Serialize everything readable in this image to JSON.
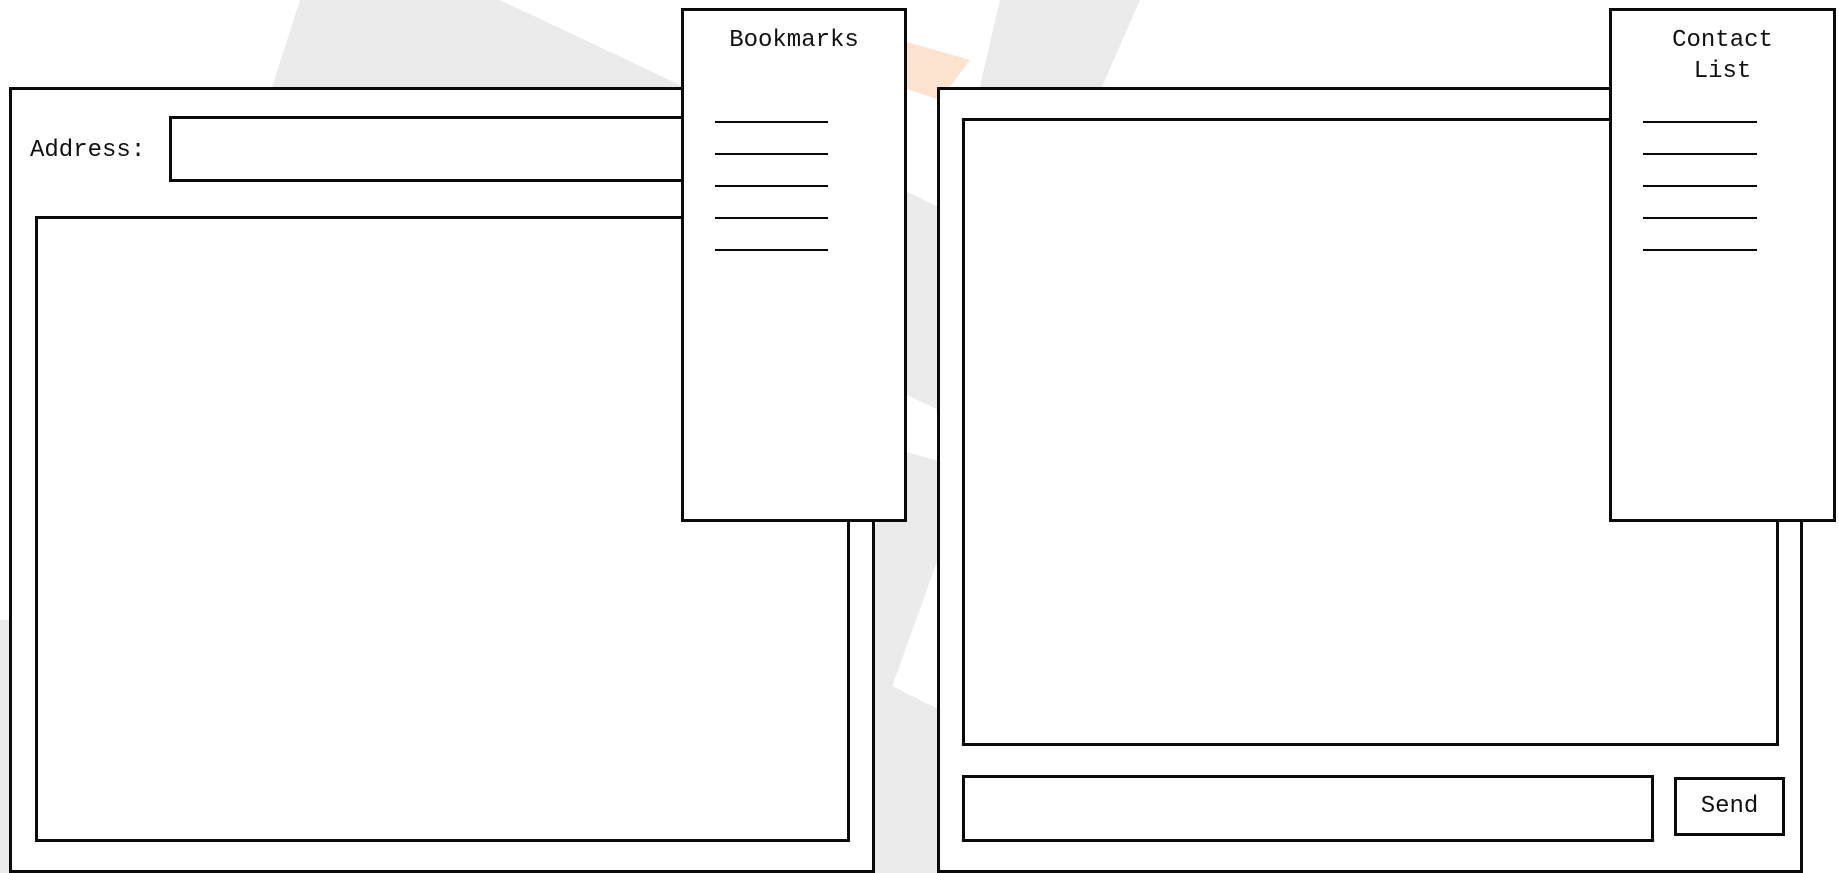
{
  "browser": {
    "address_label": "Address:",
    "address_value": ""
  },
  "bookmarks": {
    "title": "Bookmarks",
    "items": [
      "",
      "",
      "",
      "",
      ""
    ]
  },
  "messenger": {
    "message_value": "",
    "send_label": "Send"
  },
  "contacts": {
    "title": "Contact\nList",
    "items": [
      "",
      "",
      "",
      "",
      ""
    ]
  }
}
